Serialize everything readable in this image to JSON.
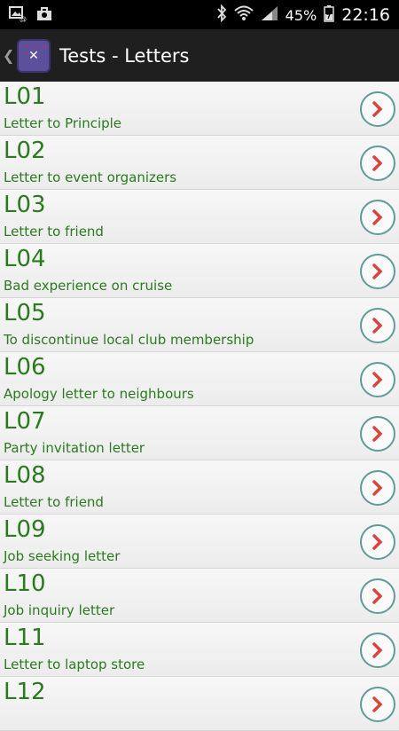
{
  "status_bar": {
    "battery": "45%",
    "time": "22:16"
  },
  "action_bar": {
    "title": "Tests - Letters"
  },
  "items": [
    {
      "code": "L01",
      "desc": "Letter to Principle"
    },
    {
      "code": "L02",
      "desc": "Letter to event organizers"
    },
    {
      "code": "L03",
      "desc": "Letter to friend"
    },
    {
      "code": "L04",
      "desc": "Bad experience on cruise"
    },
    {
      "code": "L05",
      "desc": "To discontinue local club membership"
    },
    {
      "code": "L06",
      "desc": "Apology letter to neighbours"
    },
    {
      "code": "L07",
      "desc": "Party invitation letter"
    },
    {
      "code": "L08",
      "desc": "Letter to friend"
    },
    {
      "code": "L09",
      "desc": "Job seeking letter"
    },
    {
      "code": "L10",
      "desc": "Job inquiry letter"
    },
    {
      "code": "L11",
      "desc": "Letter to laptop store"
    },
    {
      "code": "L12",
      "desc": ""
    }
  ],
  "colors": {
    "accent_green": "#2a7a1e",
    "chevron_red": "#d9443e",
    "chevron_ring": "#5f9c98"
  }
}
